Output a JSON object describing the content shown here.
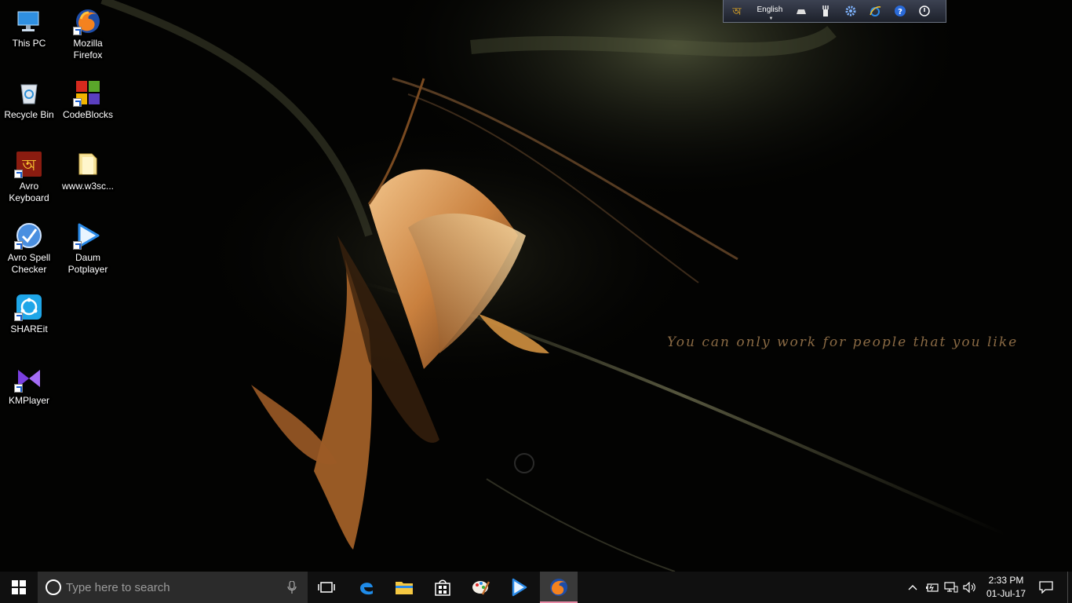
{
  "wallpaper": {
    "quote": "You can only work for people that you like"
  },
  "desktop": {
    "icons": [
      {
        "label": "This PC",
        "icon": "this-pc-icon"
      },
      {
        "label": "Mozilla Firefox",
        "icon": "firefox-icon"
      },
      {
        "label": "Recycle Bin",
        "icon": "recycle-bin-icon"
      },
      {
        "label": "CodeBlocks",
        "icon": "codeblocks-icon"
      },
      {
        "label": "Avro Keyboard",
        "icon": "avro-keyboard-icon"
      },
      {
        "label": "www.w3sc...",
        "icon": "folder-icon"
      },
      {
        "label": "Avro Spell Checker",
        "icon": "avro-spell-checker-icon"
      },
      {
        "label": "Daum Potplayer",
        "icon": "potplayer-icon"
      },
      {
        "label": "SHAREit",
        "icon": "shareit-icon"
      },
      {
        "label": "KMPlayer",
        "icon": "kmplayer-icon"
      }
    ]
  },
  "avro_toolbar": {
    "language": "English",
    "buttons": [
      "avro-logo-icon",
      "keyboard-layout-icon",
      "layout-editor-icon",
      "settings-icon",
      "internet-explorer-icon",
      "help-icon",
      "power-icon"
    ]
  },
  "taskbar": {
    "search_placeholder": "Type here to search",
    "pinned": [
      "task-view-icon",
      "edge-icon",
      "file-explorer-icon",
      "store-icon",
      "paint-icon",
      "potplayer-icon",
      "firefox-icon"
    ],
    "active": "firefox-icon",
    "tray": [
      "show-hidden-icons-icon",
      "battery-icon",
      "network-icon",
      "volume-icon"
    ],
    "time": "2:33 PM",
    "date": "01-Jul-17"
  },
  "colors": {
    "taskbar_bg": "#101010",
    "search_bg": "#2b2b2b",
    "active_indicator": "#e88aa6",
    "quote_text": "#8a6a44"
  }
}
